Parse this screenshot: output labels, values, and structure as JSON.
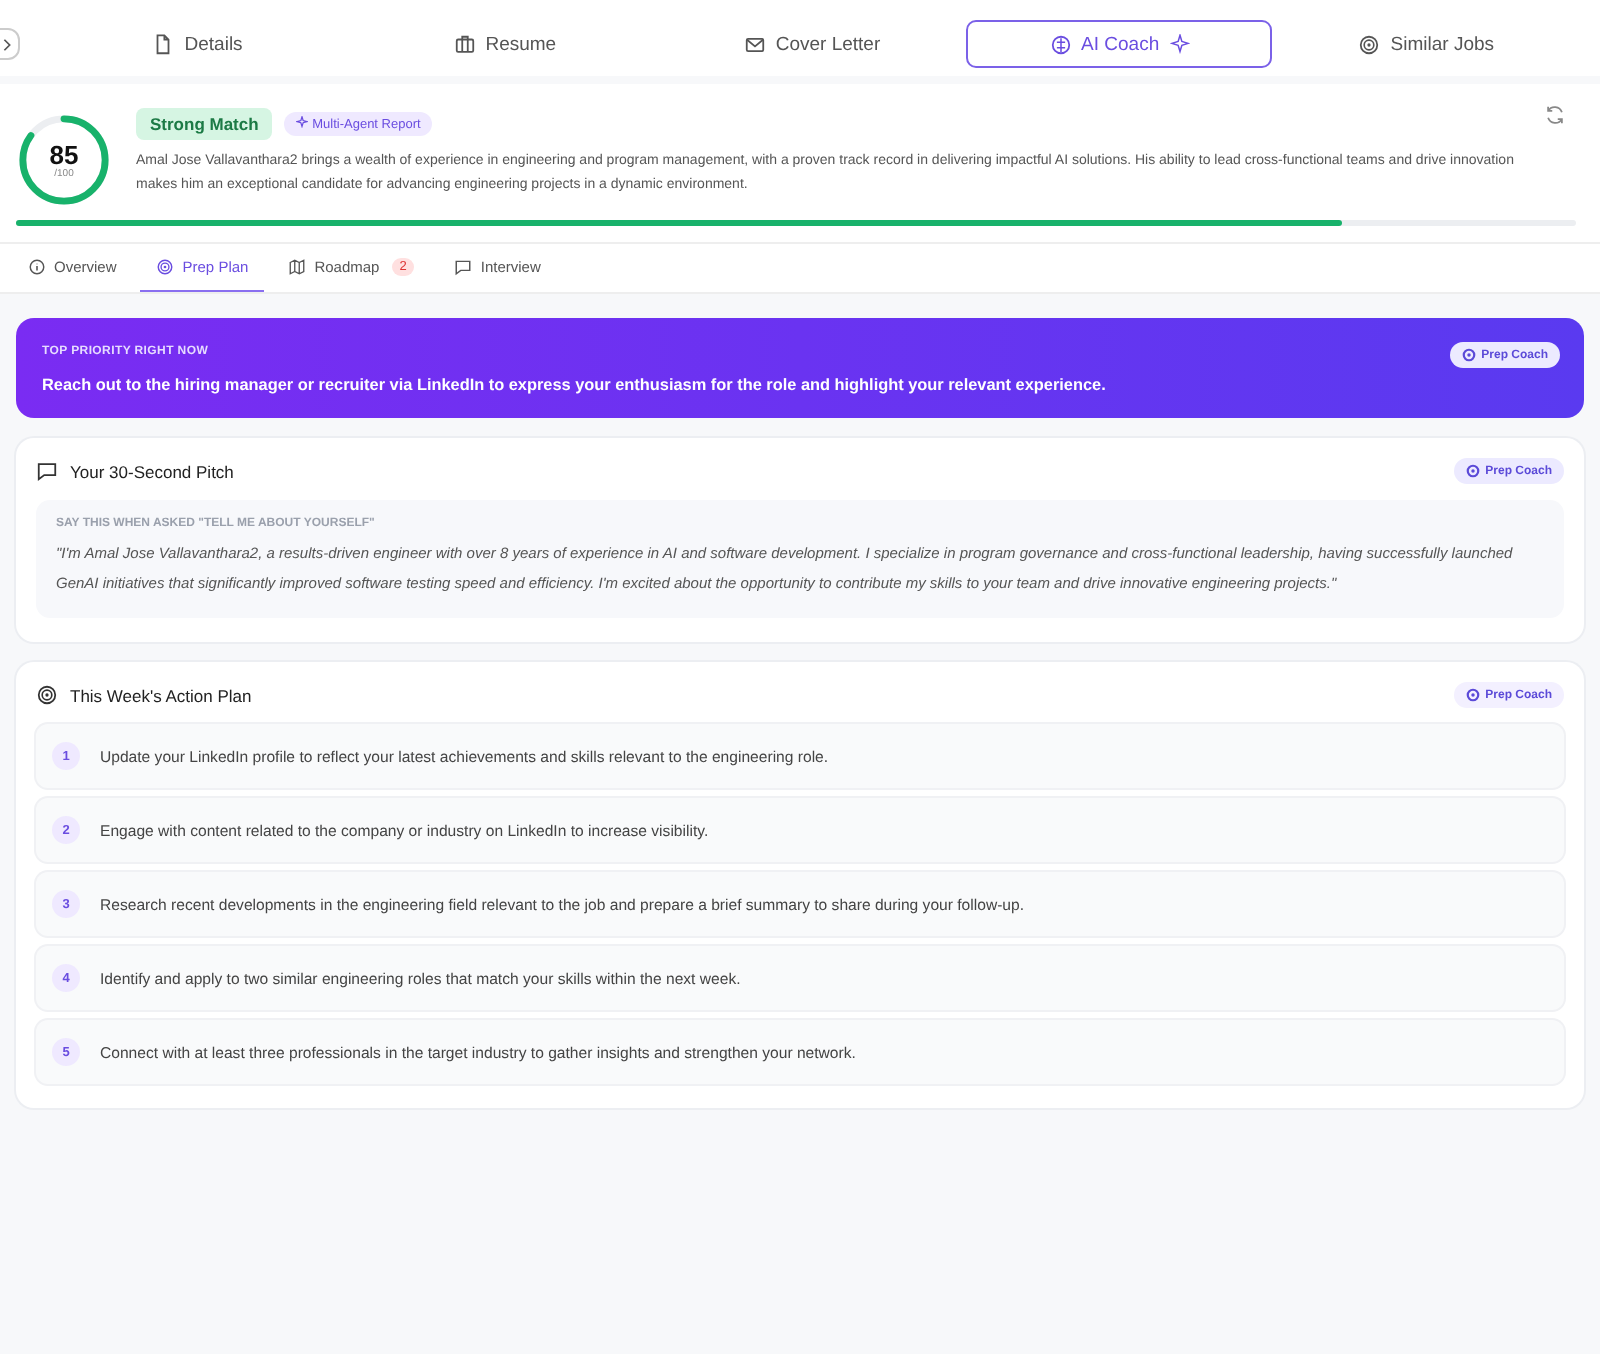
{
  "main_tabs": [
    {
      "label": "Details",
      "selected": false
    },
    {
      "label": "Resume",
      "selected": false
    },
    {
      "label": "Cover Letter",
      "selected": false
    },
    {
      "label": "AI Coach",
      "selected": true
    },
    {
      "label": "Similar Jobs",
      "selected": false
    }
  ],
  "match": {
    "score": "85",
    "out_of": "/100",
    "badge": "Strong Match",
    "report_badge": "Multi-Agent Report",
    "summary": "Amal Jose Vallavanthara2 brings a wealth of experience in engineering and program management, with a proven track record in delivering impactful AI solutions. His ability to lead cross-functional teams and drive innovation makes him an exceptional candidate for advancing engineering projects in a dynamic environment.",
    "progress": {
      "level": 0.85
    }
  },
  "sub_tabs": [
    {
      "label": "Overview",
      "selected": false
    },
    {
      "label": "Prep Plan",
      "selected": true
    },
    {
      "label": "Roadmap",
      "selected": false,
      "count": "2"
    },
    {
      "label": "Interview",
      "selected": false
    }
  ],
  "priority": {
    "label": "TOP PRIORITY RIGHT NOW",
    "text": "Reach out to the hiring manager or recruiter via LinkedIn to express your enthusiasm for the role and highlight your relevant experience.",
    "badge": "Prep Coach"
  },
  "pitch": {
    "title": "Your 30-Second Pitch",
    "badge": "Prep Coach",
    "label": "SAY THIS WHEN ASKED \"TELL ME ABOUT YOURSELF\"",
    "quote": "\"I'm Amal Jose Vallavanthara2, a results-driven engineer with over 8 years of experience in AI and software development. I specialize in program governance and cross-functional leadership, having successfully launched GenAI initiatives that significantly improved software testing speed and efficiency. I'm excited about the opportunity to contribute my skills to your team and drive innovative engineering projects.\""
  },
  "action_plan": {
    "title": "This Week's Action Plan",
    "badge": "Prep Coach",
    "items": [
      {
        "number": "1",
        "text": "Update your LinkedIn profile to reflect your latest achievements and skills relevant to the engineering role."
      },
      {
        "number": "2",
        "text": "Engage with content related to the company or industry on LinkedIn to increase visibility."
      },
      {
        "number": "3",
        "text": "Research recent developments in the engineering field relevant to the job and prepare a brief summary to share during your follow-up."
      },
      {
        "number": "4",
        "text": "Identify and apply to two similar engineering roles that match your skills within the next week."
      },
      {
        "number": "5",
        "text": "Connect with at least three professionals in the target industry to gather insights and strengthen your network."
      }
    ]
  }
}
